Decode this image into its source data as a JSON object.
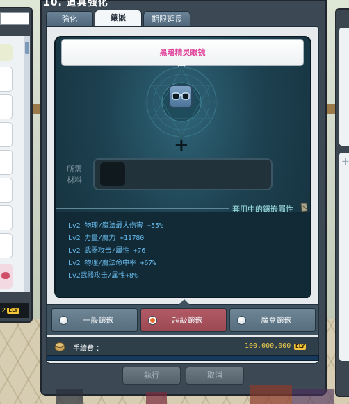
{
  "window": {
    "title": "10. 道具強化"
  },
  "tabs": [
    {
      "label": "強化",
      "active": false
    },
    {
      "label": "鑲嵌",
      "active": true
    },
    {
      "label": "期限延長",
      "active": false
    }
  ],
  "item": {
    "name": "黑暗精灵眼镜",
    "icon": "glasses-icon"
  },
  "material": {
    "label": "所需材料"
  },
  "applied": {
    "label": "套用中的鑲嵌屬性"
  },
  "stats": [
    "Lv2 物理/魔法最大伤害 +55%",
    "Lv2 力量/魔力 +11780",
    "Lv2 武器攻击/属性 +76",
    "Lv2 物理/魔法命中率 +67%",
    "Lv2武器攻击/属性+8%"
  ],
  "options": [
    {
      "label": "一般鑲嵌",
      "selected": false
    },
    {
      "label": "超級鑲嵌",
      "selected": true
    },
    {
      "label": "魔盒鑲嵌",
      "selected": false
    }
  ],
  "fee": {
    "label": "手續費 ：",
    "value": "100,000,000",
    "currency": "ELY"
  },
  "buttons": {
    "execute": "執行",
    "cancel": "取消"
  },
  "left_panel": {
    "money": "2",
    "currency": "ELY"
  },
  "colors": {
    "item_name": "#e0429a",
    "stat_text": "#66b8ea",
    "selected_option": "#b25a66",
    "fee_value": "#f3d24a"
  }
}
